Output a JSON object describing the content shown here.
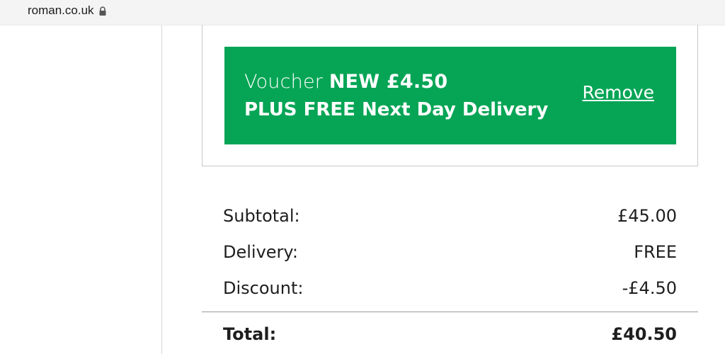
{
  "browser": {
    "url": "roman.co.uk",
    "lock_icon": "lock-icon"
  },
  "voucher": {
    "prefix": "Voucher",
    "code": "NEW £4.50",
    "offer": "PLUS FREE Next Day Delivery",
    "remove_label": "Remove",
    "color": "#06a555"
  },
  "summary": {
    "subtotal_label": "Subtotal:",
    "subtotal_value": "£45.00",
    "delivery_label": "Delivery:",
    "delivery_value": "FREE",
    "discount_label": "Discount:",
    "discount_value": "-£4.50",
    "total_label": "Total:",
    "total_value": "£40.50"
  }
}
